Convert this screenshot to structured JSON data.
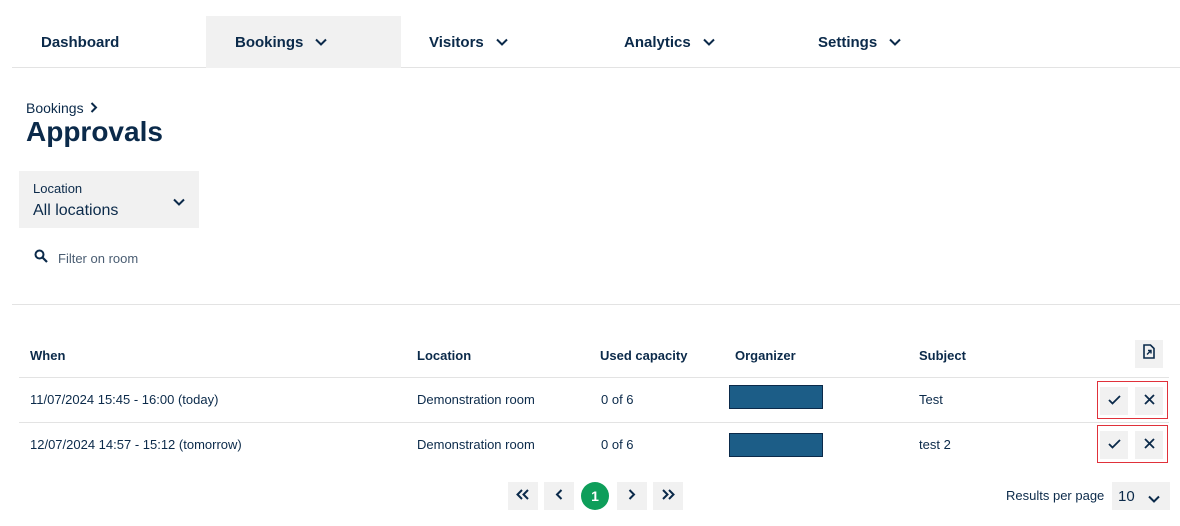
{
  "nav": {
    "items": [
      {
        "label": "Dashboard"
      },
      {
        "label": "Bookings"
      },
      {
        "label": "Visitors"
      },
      {
        "label": "Analytics"
      },
      {
        "label": "Settings"
      }
    ]
  },
  "breadcrumb": {
    "parent": "Bookings"
  },
  "page": {
    "title": "Approvals"
  },
  "location_filter": {
    "label": "Location",
    "value": "All locations"
  },
  "room_filter": {
    "placeholder": "Filter on room"
  },
  "table": {
    "headers": {
      "when": "When",
      "location": "Location",
      "capacity": "Used capacity",
      "organizer": "Organizer",
      "subject": "Subject"
    },
    "rows": [
      {
        "when": "11/07/2024 15:45 - 16:00 (today)",
        "location": "Demonstration room",
        "capacity": "0 of 6",
        "subject": "Test"
      },
      {
        "when": "12/07/2024 14:57 - 15:12 (tomorrow)",
        "location": "Demonstration room",
        "capacity": "0 of 6",
        "subject": "test 2"
      }
    ]
  },
  "pagination": {
    "current_page": "1",
    "results_per_page_label": "Results per page",
    "results_per_page": "10"
  },
  "icons": {
    "chevron": "chevron-down-icon",
    "search": "search-icon",
    "export": "export-file-icon",
    "approve": "check-icon",
    "reject": "close-icon"
  },
  "colors": {
    "text": "#0b2a4a",
    "accent": "#0e9e5a",
    "redacted": "#1c5d87",
    "highlight": "#e0313a",
    "surface": "#f1f1f1"
  }
}
